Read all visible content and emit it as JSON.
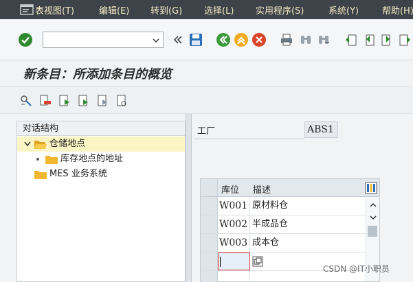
{
  "menubar": {
    "items": [
      "表视图(T)",
      "编辑(E)",
      "转到(G)",
      "选择(L)",
      "实用程序(S)",
      "系统(Y)",
      "帮助(H)"
    ],
    "bg_color": "#3d4349",
    "text_color": "#f3e8c5"
  },
  "toolbar": {
    "command_field_value": "",
    "icons": [
      "enter-check-icon",
      "command-field",
      "double-chevron-left-icon",
      "save-icon",
      "back-icon",
      "exit-icon",
      "cancel-icon",
      "print-icon",
      "find-icon",
      "find-next-icon",
      "first-page-icon",
      "previous-page-icon",
      "next-page-icon",
      "last-page-icon"
    ]
  },
  "title": "新条目：所添加条目的概览",
  "tree": {
    "header": "对话结构",
    "items": [
      {
        "label": "仓储地点",
        "level": 0,
        "expanded": true,
        "selected": true
      },
      {
        "label": "库存地点的地址",
        "level": 1,
        "expanded": false,
        "selected": false
      },
      {
        "label": "MES 业务系统",
        "level": 0,
        "expanded": false,
        "selected": false
      }
    ]
  },
  "form": {
    "plant_label": "工厂",
    "plant_value": "ABS1"
  },
  "table": {
    "columns": [
      "库位",
      "描述"
    ],
    "rows": [
      {
        "code": "W001",
        "desc": "原材料仓"
      },
      {
        "code": "W002",
        "desc": "半成品仓"
      },
      {
        "code": "W003",
        "desc": "成本仓"
      },
      {
        "code": "",
        "desc": ""
      },
      {
        "code": "",
        "desc": ""
      }
    ]
  },
  "watermark": "CSDN @IT小职员",
  "colors": {
    "accent_green": "#2f8a2f",
    "save_blue": "#2a6fb7",
    "tree_selected": "#fbf4c4",
    "folder_yellow": "#f2b731",
    "focus_red": "#d9362b"
  }
}
